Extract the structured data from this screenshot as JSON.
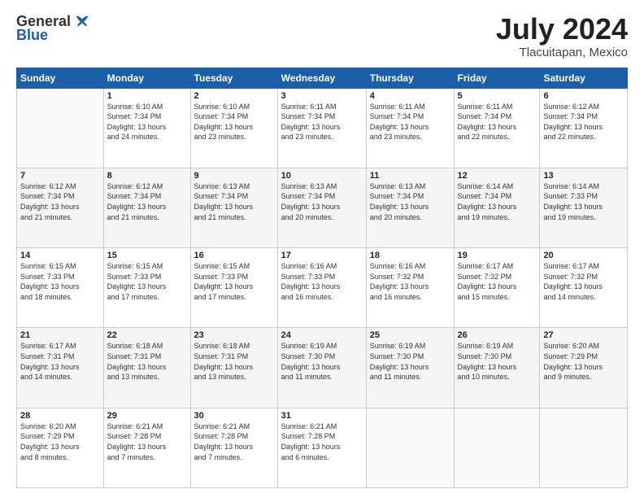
{
  "logo": {
    "general": "General",
    "blue": "Blue"
  },
  "header": {
    "month": "July 2024",
    "location": "Tlacuitapan, Mexico"
  },
  "weekdays": [
    "Sunday",
    "Monday",
    "Tuesday",
    "Wednesday",
    "Thursday",
    "Friday",
    "Saturday"
  ],
  "weeks": [
    [
      {
        "day": null,
        "info": null
      },
      {
        "day": "1",
        "info": "Sunrise: 6:10 AM\nSunset: 7:34 PM\nDaylight: 13 hours\nand 24 minutes."
      },
      {
        "day": "2",
        "info": "Sunrise: 6:10 AM\nSunset: 7:34 PM\nDaylight: 13 hours\nand 23 minutes."
      },
      {
        "day": "3",
        "info": "Sunrise: 6:11 AM\nSunset: 7:34 PM\nDaylight: 13 hours\nand 23 minutes."
      },
      {
        "day": "4",
        "info": "Sunrise: 6:11 AM\nSunset: 7:34 PM\nDaylight: 13 hours\nand 23 minutes."
      },
      {
        "day": "5",
        "info": "Sunrise: 6:11 AM\nSunset: 7:34 PM\nDaylight: 13 hours\nand 22 minutes."
      },
      {
        "day": "6",
        "info": "Sunrise: 6:12 AM\nSunset: 7:34 PM\nDaylight: 13 hours\nand 22 minutes."
      }
    ],
    [
      {
        "day": "7",
        "info": "Sunrise: 6:12 AM\nSunset: 7:34 PM\nDaylight: 13 hours\nand 21 minutes."
      },
      {
        "day": "8",
        "info": "Sunrise: 6:12 AM\nSunset: 7:34 PM\nDaylight: 13 hours\nand 21 minutes."
      },
      {
        "day": "9",
        "info": "Sunrise: 6:13 AM\nSunset: 7:34 PM\nDaylight: 13 hours\nand 21 minutes."
      },
      {
        "day": "10",
        "info": "Sunrise: 6:13 AM\nSunset: 7:34 PM\nDaylight: 13 hours\nand 20 minutes."
      },
      {
        "day": "11",
        "info": "Sunrise: 6:13 AM\nSunset: 7:34 PM\nDaylight: 13 hours\nand 20 minutes."
      },
      {
        "day": "12",
        "info": "Sunrise: 6:14 AM\nSunset: 7:34 PM\nDaylight: 13 hours\nand 19 minutes."
      },
      {
        "day": "13",
        "info": "Sunrise: 6:14 AM\nSunset: 7:33 PM\nDaylight: 13 hours\nand 19 minutes."
      }
    ],
    [
      {
        "day": "14",
        "info": "Sunrise: 6:15 AM\nSunset: 7:33 PM\nDaylight: 13 hours\nand 18 minutes."
      },
      {
        "day": "15",
        "info": "Sunrise: 6:15 AM\nSunset: 7:33 PM\nDaylight: 13 hours\nand 17 minutes."
      },
      {
        "day": "16",
        "info": "Sunrise: 6:15 AM\nSunset: 7:33 PM\nDaylight: 13 hours\nand 17 minutes."
      },
      {
        "day": "17",
        "info": "Sunrise: 6:16 AM\nSunset: 7:33 PM\nDaylight: 13 hours\nand 16 minutes."
      },
      {
        "day": "18",
        "info": "Sunrise: 6:16 AM\nSunset: 7:32 PM\nDaylight: 13 hours\nand 16 minutes."
      },
      {
        "day": "19",
        "info": "Sunrise: 6:17 AM\nSunset: 7:32 PM\nDaylight: 13 hours\nand 15 minutes."
      },
      {
        "day": "20",
        "info": "Sunrise: 6:17 AM\nSunset: 7:32 PM\nDaylight: 13 hours\nand 14 minutes."
      }
    ],
    [
      {
        "day": "21",
        "info": "Sunrise: 6:17 AM\nSunset: 7:31 PM\nDaylight: 13 hours\nand 14 minutes."
      },
      {
        "day": "22",
        "info": "Sunrise: 6:18 AM\nSunset: 7:31 PM\nDaylight: 13 hours\nand 13 minutes."
      },
      {
        "day": "23",
        "info": "Sunrise: 6:18 AM\nSunset: 7:31 PM\nDaylight: 13 hours\nand 13 minutes."
      },
      {
        "day": "24",
        "info": "Sunrise: 6:19 AM\nSunset: 7:30 PM\nDaylight: 13 hours\nand 11 minutes."
      },
      {
        "day": "25",
        "info": "Sunrise: 6:19 AM\nSunset: 7:30 PM\nDaylight: 13 hours\nand 11 minutes."
      },
      {
        "day": "26",
        "info": "Sunrise: 6:19 AM\nSunset: 7:30 PM\nDaylight: 13 hours\nand 10 minutes."
      },
      {
        "day": "27",
        "info": "Sunrise: 6:20 AM\nSunset: 7:29 PM\nDaylight: 13 hours\nand 9 minutes."
      }
    ],
    [
      {
        "day": "28",
        "info": "Sunrise: 6:20 AM\nSunset: 7:29 PM\nDaylight: 13 hours\nand 8 minutes."
      },
      {
        "day": "29",
        "info": "Sunrise: 6:21 AM\nSunset: 7:28 PM\nDaylight: 13 hours\nand 7 minutes."
      },
      {
        "day": "30",
        "info": "Sunrise: 6:21 AM\nSunset: 7:28 PM\nDaylight: 13 hours\nand 7 minutes."
      },
      {
        "day": "31",
        "info": "Sunrise: 6:21 AM\nSunset: 7:28 PM\nDaylight: 13 hours\nand 6 minutes."
      },
      {
        "day": null,
        "info": null
      },
      {
        "day": null,
        "info": null
      },
      {
        "day": null,
        "info": null
      }
    ]
  ]
}
